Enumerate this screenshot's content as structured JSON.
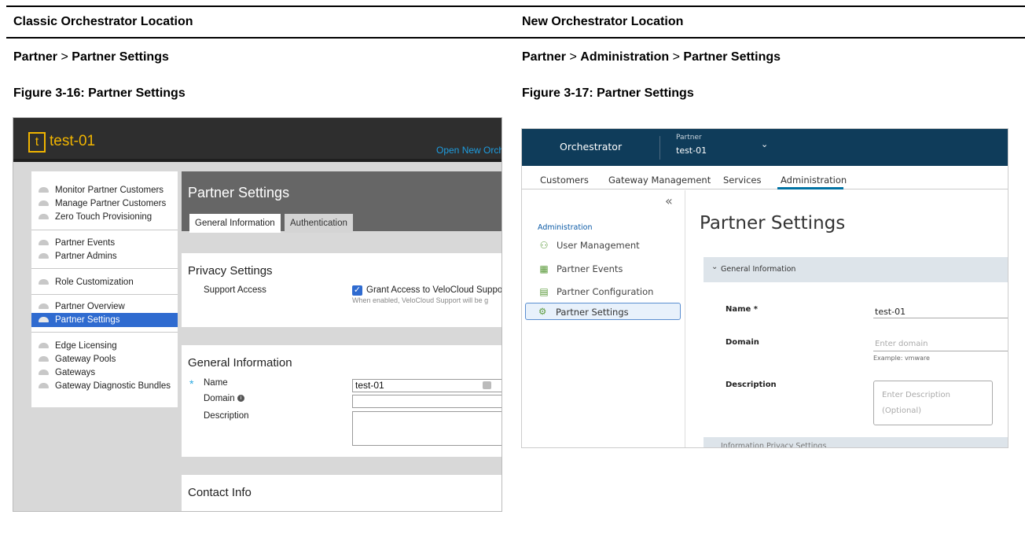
{
  "left_col": {
    "header": "Classic Orchestrator Location",
    "breadcrumb": [
      "Partner",
      ">",
      "Partner Settings"
    ],
    "figure_caption": "Figure 3-16: Partner Settings"
  },
  "right_col": {
    "header": "New Orchestrator Location",
    "breadcrumb": [
      "Partner",
      ">",
      "Administration",
      ">",
      "Partner Settings"
    ],
    "figure_caption": "Figure 3-17: Partner Settings"
  },
  "classic": {
    "logo_letter": "t",
    "customer_name": "test-01",
    "open_new_link": "Open New Orch",
    "sidebar": [
      {
        "label": "Monitor Partner Customers",
        "selected": false
      },
      {
        "label": "Manage Partner Customers",
        "selected": false
      },
      {
        "label": "Zero Touch Provisioning",
        "selected": false
      },
      {
        "label": "Partner Events",
        "selected": false
      },
      {
        "label": "Partner Admins",
        "selected": false
      },
      {
        "label": "Role Customization",
        "selected": false
      },
      {
        "label": "Partner Overview",
        "selected": false
      },
      {
        "label": "Partner Settings",
        "selected": true
      },
      {
        "label": "Edge Licensing",
        "selected": false
      },
      {
        "label": "Gateway Pools",
        "selected": false
      },
      {
        "label": "Gateways",
        "selected": false
      },
      {
        "label": "Gateway Diagnostic Bundles",
        "selected": false
      }
    ],
    "page_title": "Partner Settings",
    "tabs": [
      "General Information",
      "Authentication"
    ],
    "active_tab": "General Information",
    "privacy": {
      "title": "Privacy Settings",
      "support_access_label": "Support Access",
      "checkbox_label": "Grant Access to VeloCloud Support",
      "checkbox_checked": true,
      "hint": "When enabled, VeloCloud Support will be g"
    },
    "general": {
      "title": "General Information",
      "required_mark": "*",
      "name_label": "Name",
      "name_value": "test-01",
      "domain_label": "Domain",
      "description_label": "Description"
    },
    "contact_title": "Contact Info"
  },
  "new": {
    "brand": "Orchestrator",
    "partner_label": "Partner",
    "partner_value": "test-01",
    "tabs": [
      "Customers",
      "Gateway Management",
      "Services",
      "Administration"
    ],
    "active_tab": "Administration",
    "collapse_glyph": "«",
    "sidebar_heading": "Administration",
    "sidebar": [
      {
        "label": "User Management",
        "icon": "users-icon"
      },
      {
        "label": "Partner Events",
        "icon": "calendar-icon"
      },
      {
        "label": "Partner Configuration",
        "icon": "book-icon"
      },
      {
        "label": "Partner Settings",
        "icon": "gear-icon",
        "selected": true
      }
    ],
    "page_title": "Partner Settings",
    "section_title": "General Information",
    "name_label": "Name *",
    "name_value": "test-01",
    "domain_label": "Domain",
    "domain_placeholder": "Enter domain",
    "domain_hint": "Example: vmware",
    "description_label": "Description",
    "description_placeholder": "Enter Description (Optional)",
    "next_section_title": "Information Privacy Settings"
  }
}
